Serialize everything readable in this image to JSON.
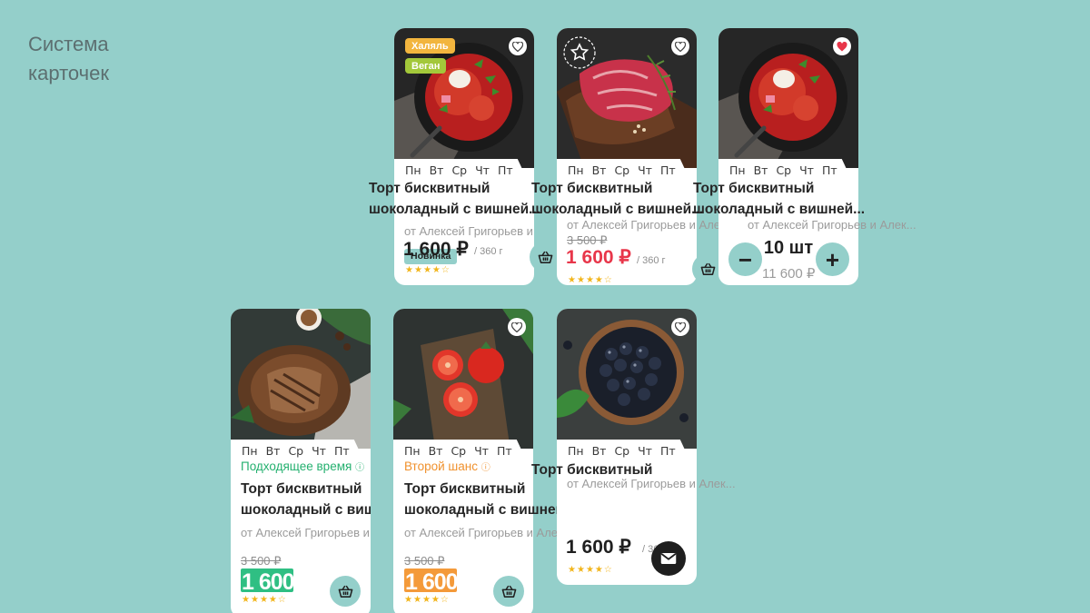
{
  "page": {
    "title_line1": "Система",
    "title_line2": "карточек"
  },
  "days": [
    "Пн",
    "Вт",
    "Ср",
    "Чт",
    "Пт"
  ],
  "product": {
    "title_line1": "Торт бисквитный",
    "title_line2": "шоколадный с вишней...",
    "author": "от Алексей Григорьев и Алек...",
    "unit": "/ 360 г"
  },
  "cards": {
    "c1": {
      "tags": [
        "Халяль",
        "Веган"
      ],
      "price": "1 600 ₽",
      "badge": "Новинка"
    },
    "c2": {
      "price": "1 600 ₽",
      "old_price": "3 500 ₽"
    },
    "c3": {
      "qty": "10 шт",
      "total": "11 600 ₽",
      "minus": "−",
      "plus": "+"
    },
    "c4": {
      "label": "Подходящее время",
      "old_price": "3 500 ₽",
      "price": "1 600 ₽"
    },
    "c5": {
      "label": "Второй шанс",
      "old_price": "3 500 ₽",
      "price": "1 600 ₽"
    },
    "c6": {
      "price": "1 600 ₽"
    }
  },
  "colors": {
    "background": "#94cfca",
    "accent_red": "#e8364a",
    "halal": "#f2b53e",
    "vegan": "#a3c83a",
    "green_promo": "#2fbf83",
    "orange_promo": "#f49a3a"
  },
  "ratings": {
    "c1": 4,
    "c2": 4,
    "c4": 4,
    "c5": 4,
    "c6": 4
  },
  "icons": {
    "favorite": "heart-outline-icon",
    "favorite_active": "heart-filled-icon",
    "cart": "basket-icon",
    "mail": "envelope-icon",
    "seal": "quality-seal-icon"
  }
}
